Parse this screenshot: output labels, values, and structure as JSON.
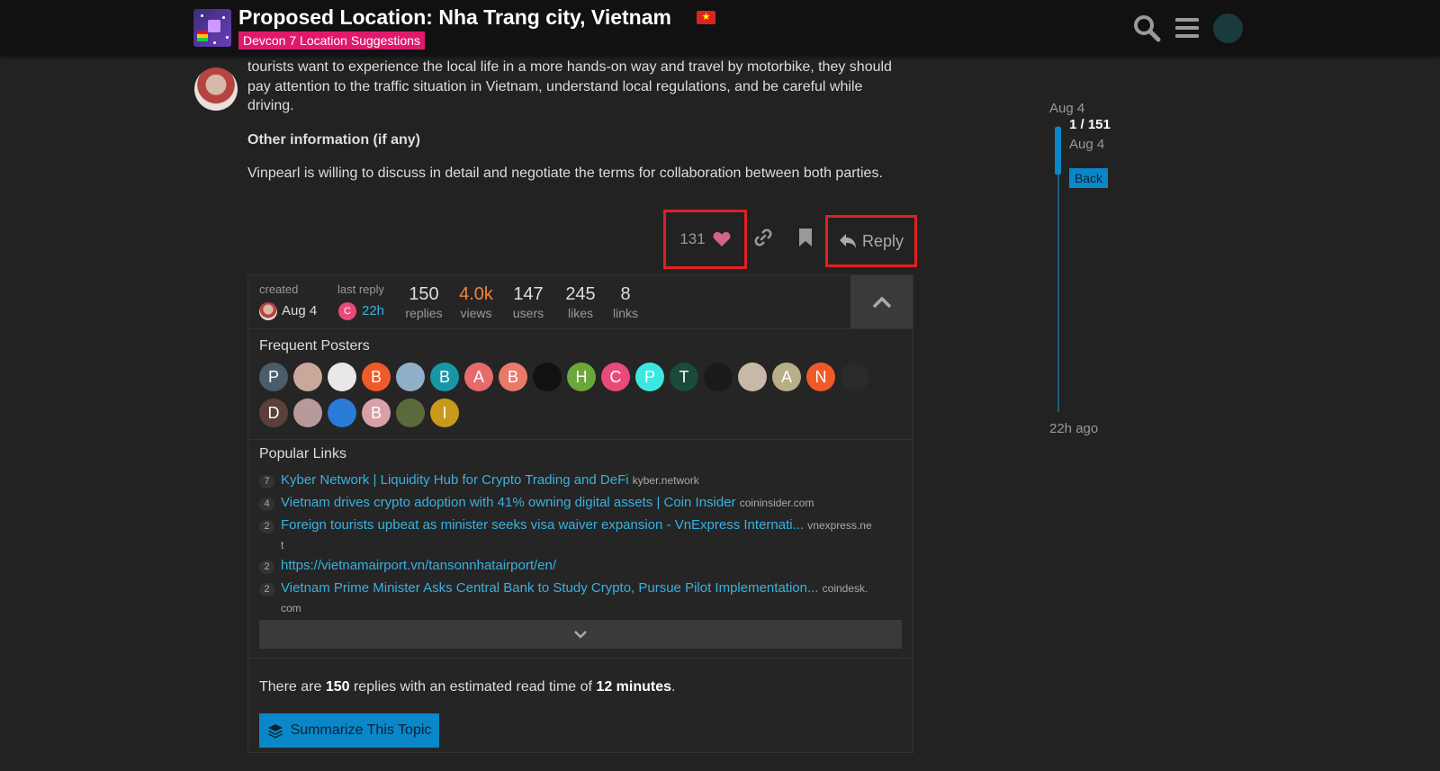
{
  "header": {
    "title": "Proposed Location: Nha Trang city, Vietnam",
    "flag": "★",
    "category": "Devcon 7 Location Suggestions"
  },
  "post": {
    "paragraph": "tourists want to experience the local life in a more hands-on way and travel by motorbike, they should pay attention to the traffic situation in Vietnam, understand local regulations, and be careful while driving.",
    "heading": "Other information (if any)",
    "closing": "Vinpearl is willing to discuss in detail and negotiate the terms for collaboration between both parties."
  },
  "actions": {
    "like_count": "131",
    "reply_label": "Reply"
  },
  "topic_map": {
    "created_label": "created",
    "created_date": "Aug 4",
    "last_reply_label": "last reply",
    "last_reply_letter": "C",
    "last_reply_time": "22h",
    "stats": [
      {
        "value": "150",
        "label": "replies"
      },
      {
        "value": "4.0k",
        "label": "views"
      },
      {
        "value": "147",
        "label": "users"
      },
      {
        "value": "245",
        "label": "likes"
      },
      {
        "value": "8",
        "label": "links"
      }
    ],
    "frequent_posters_title": "Frequent Posters",
    "posters": [
      {
        "letter": "P",
        "color": "#4b5d6a"
      },
      {
        "letter": "",
        "color": "#c9a89a"
      },
      {
        "letter": "",
        "color": "#e8e8e8"
      },
      {
        "letter": "B",
        "color": "#f05a28"
      },
      {
        "letter": "",
        "color": "#8fb0c8"
      },
      {
        "letter": "B",
        "color": "#1896a8"
      },
      {
        "letter": "A",
        "color": "#e86a6a"
      },
      {
        "letter": "B",
        "color": "#e87a6a"
      },
      {
        "letter": "",
        "color": "#111111"
      },
      {
        "letter": "H",
        "color": "#6aa83a"
      },
      {
        "letter": "C",
        "color": "#e84a7a"
      },
      {
        "letter": "P",
        "color": "#3ae8e0"
      },
      {
        "letter": "T",
        "color": "#1a4a3a"
      },
      {
        "letter": "",
        "color": "#1a1a1a"
      },
      {
        "letter": "",
        "color": "#c8b8a8"
      },
      {
        "letter": "A",
        "color": "#b8ae88"
      },
      {
        "letter": "N",
        "color": "#f05a28"
      },
      {
        "letter": "",
        "color": "#2a2a2a"
      },
      {
        "letter": "D",
        "color": "#5a4038"
      },
      {
        "letter": "",
        "color": "#b89a9a"
      },
      {
        "letter": "",
        "color": "#2a7ad8"
      },
      {
        "letter": "B",
        "color": "#d8a0a8"
      },
      {
        "letter": "",
        "color": "#5a6a3a"
      },
      {
        "letter": "I",
        "color": "#c89a1a"
      }
    ],
    "popular_links_title": "Popular Links",
    "links": [
      {
        "count": "7",
        "title": "Kyber Network | Liquidity Hub for Crypto Trading and DeFi",
        "domain": "kyber.network",
        "domain_cont": ""
      },
      {
        "count": "4",
        "title": "Vietnam drives crypto adoption with 41% owning digital assets | Coin Insider",
        "domain": "coininsider.com",
        "domain_cont": ""
      },
      {
        "count": "2",
        "title": "Foreign tourists upbeat as minister seeks visa waiver expansion - VnExpress Internati...",
        "domain": "vnexpress.ne",
        "domain_cont": "t"
      },
      {
        "count": "2",
        "title": "https://vietnamairport.vn/tansonnhatairport/en/",
        "domain": "",
        "domain_cont": ""
      },
      {
        "count": "2",
        "title": "Vietnam Prime Minister Asks Central Bank to Study Crypto, Pursue Pilot Implementation...",
        "domain": "coindesk.",
        "domain_cont": "com"
      }
    ],
    "summary": {
      "prefix": "There are ",
      "replies": "150",
      "middle": " replies with an estimated read time of ",
      "time": "12 minutes",
      "suffix": "."
    },
    "summarize_label": "Summarize This Topic"
  },
  "timeline": {
    "start_date": "Aug 4",
    "position": "1 / 151",
    "current_date": "Aug 4",
    "back_label": "Back",
    "end_label": "22h ago"
  },
  "colors": {
    "accent": "#0a87c9",
    "category": "#e0196c",
    "highlight": "#e31e24",
    "views": "#f0833a"
  }
}
